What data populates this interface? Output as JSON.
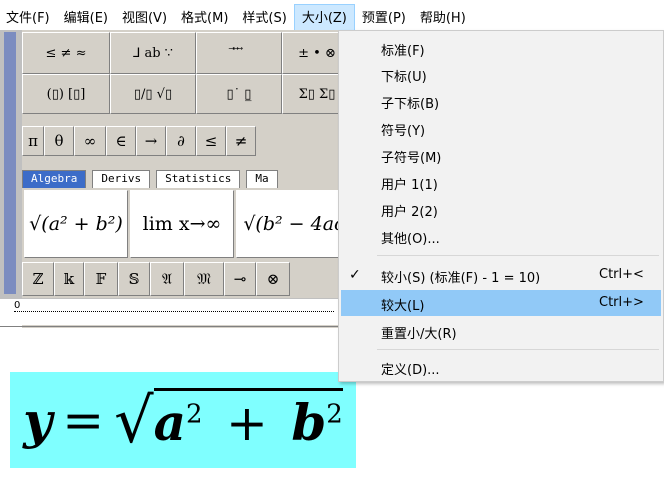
{
  "menubar": {
    "items": [
      {
        "label": "文件(F)"
      },
      {
        "label": "编辑(E)"
      },
      {
        "label": "视图(V)"
      },
      {
        "label": "格式(M)"
      },
      {
        "label": "样式(S)"
      },
      {
        "label": "大小(Z)",
        "active": true
      },
      {
        "label": "预置(P)"
      },
      {
        "label": "帮助(H)"
      }
    ]
  },
  "toolbar": {
    "row1": [
      "≤ ≠ ≈",
      "⅃ ab ∵",
      "⃗ ⃡ ⃗",
      "± • ⊗"
    ],
    "row2": [
      "(▯) [▯]",
      "▯/▯ √▯",
      "▯˙ ▯̲",
      "Σ▯ Σ▯"
    ],
    "row3": [
      "π",
      "θ",
      "∞",
      "∈",
      "→",
      "∂",
      "≤",
      "≠"
    ],
    "tabs": [
      "Algebra",
      "Derivs",
      "Statistics",
      "Ma"
    ],
    "templates": [
      "√(a² + b²)",
      "lim x→∞",
      "√(b² − 4ac"
    ],
    "row4": [
      "ℤ",
      "𝕜",
      "𝔽",
      "𝕊",
      "𝔄",
      "𝔐",
      "⊸",
      "⊗"
    ],
    "size_buttons": [
      "↥",
      "↑",
      "↑",
      "↑",
      "↑"
    ]
  },
  "ruler": {
    "origin_label": "0"
  },
  "equation": {
    "lhs": "y",
    "equals": "=",
    "radical": "√",
    "a": "a",
    "exp1": "2",
    "plus": "+",
    "b": "b",
    "exp2": "2"
  },
  "dropdown": {
    "items": [
      {
        "label": "标准(F)"
      },
      {
        "label": "下标(U)"
      },
      {
        "label": "子下标(B)"
      },
      {
        "label": "符号(Y)"
      },
      {
        "label": "子符号(M)"
      },
      {
        "label": "用户 1(1)"
      },
      {
        "label": "用户 2(2)"
      },
      {
        "label": "其他(O)..."
      },
      {
        "label": "较小(S) (标准(F) - 1 = 10)",
        "shortcut": "Ctrl+<",
        "checked": "✓"
      },
      {
        "label": "较大(L)",
        "shortcut": "Ctrl+>"
      },
      {
        "label": "重置小/大(R)"
      },
      {
        "label": "定义(D)..."
      }
    ]
  }
}
